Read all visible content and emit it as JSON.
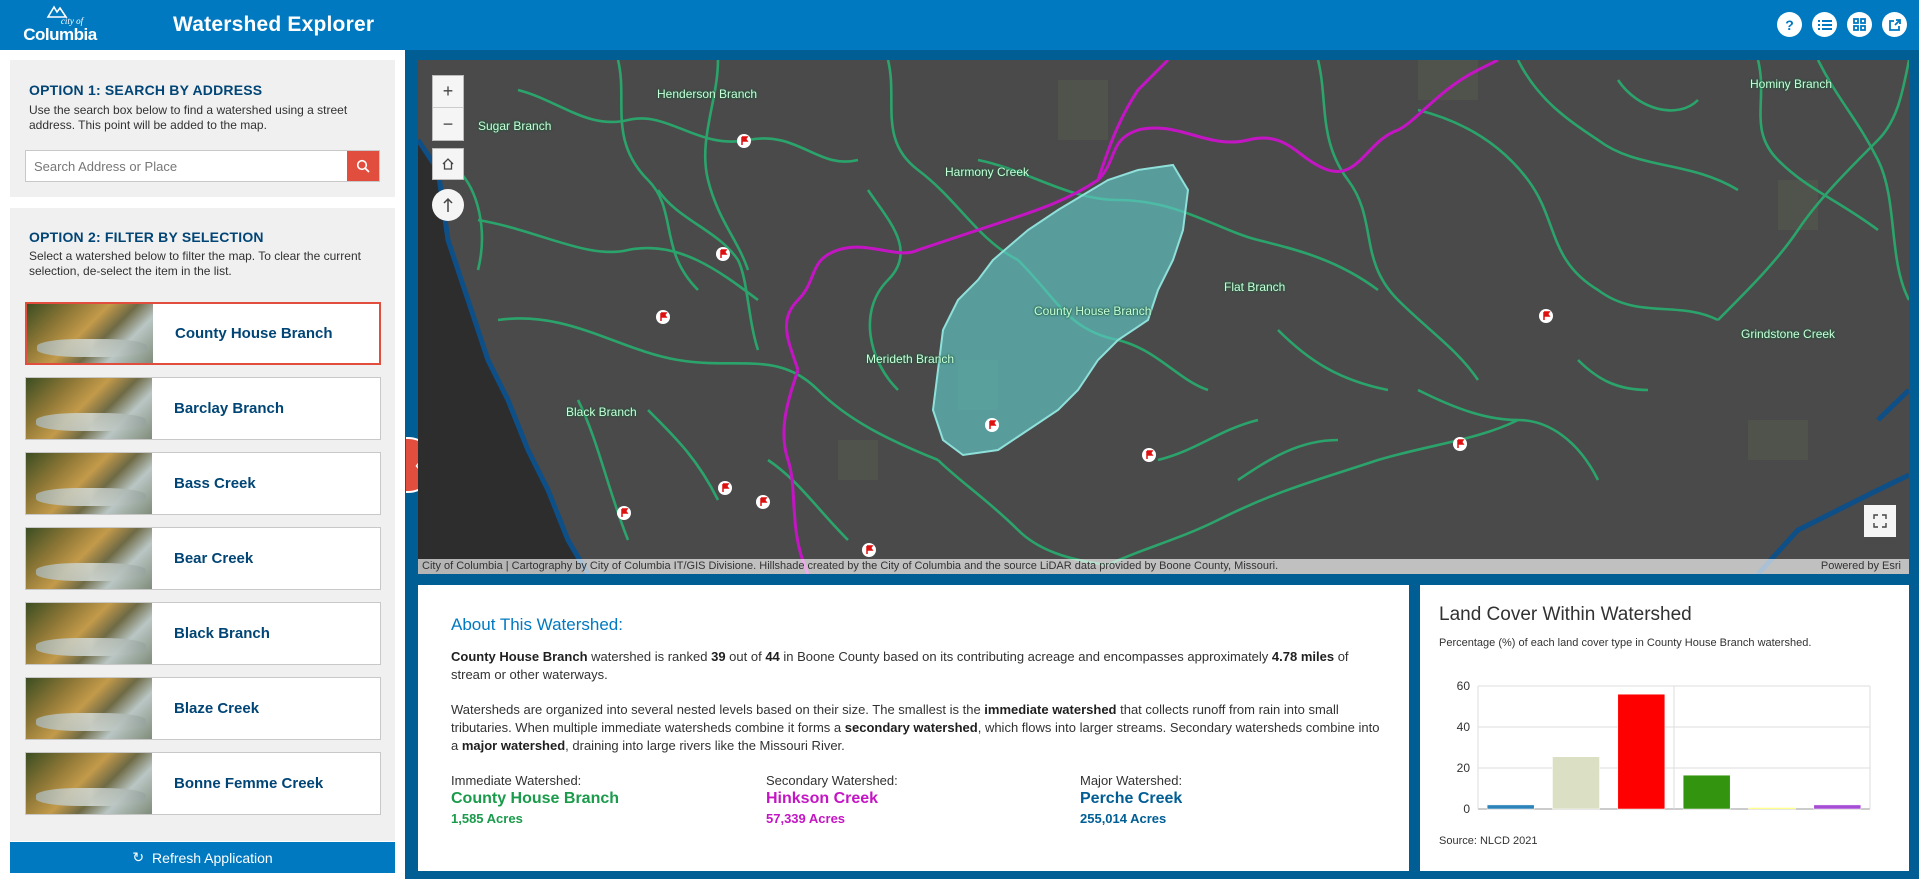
{
  "header": {
    "logo_top": "city of",
    "logo_name": "Columbia",
    "title": "Watershed Explorer",
    "icons": [
      "help-icon",
      "list-icon",
      "grid-icon",
      "share-icon"
    ],
    "bg_color": "#0079c1"
  },
  "option1": {
    "title": "OPTION 1: SEARCH BY ADDRESS",
    "description": "Use the search box below to find a watershed using a street address. This point will be added to the map.",
    "search_placeholder": "Search Address or Place"
  },
  "option2": {
    "title": "OPTION 2: FILTER BY SELECTION",
    "description": "Select a watershed below to filter the map.  To clear the current selection, de-select the item in the list.",
    "items": [
      {
        "label": "County House Branch",
        "selected": true
      },
      {
        "label": "Barclay Branch",
        "selected": false
      },
      {
        "label": "Bass Creek",
        "selected": false
      },
      {
        "label": "Bear Creek",
        "selected": false
      },
      {
        "label": "Black Branch",
        "selected": false
      },
      {
        "label": "Blaze Creek",
        "selected": false
      },
      {
        "label": "Bonne Femme Creek",
        "selected": false
      }
    ]
  },
  "refresh_label": "Refresh Application",
  "map": {
    "labels": [
      "Henderson Branch",
      "Sugar Branch",
      "Harmony Creek",
      "Hominy Branch",
      "County House Branch",
      "Flat Branch",
      "Grindstone Creek",
      "Merideth Branch",
      "Black Branch"
    ],
    "zoom_in": "+",
    "zoom_out": "−",
    "attribution": "City of Columbia | Cartography by City of Columbia IT/GIS Divisione. Hillshade created by the City of Columbia and the source LiDAR data provided by Boone County, Missouri.",
    "powered_by": "Powered by Esri"
  },
  "about": {
    "title": "About This Watershed:",
    "p1_name": "County House Branch",
    "p1_a": " watershed is ranked ",
    "p1_rank": "39",
    "p1_b": " out of ",
    "p1_total": "44",
    "p1_c": " in Boone County based on its contributing acreage and encompasses approximately ",
    "p1_miles": "4.78 miles",
    "p1_d": " of stream or other waterways.",
    "p2_a": "Watersheds are organized into several nested levels based on their size. The smallest is the ",
    "p2_b1": "immediate watershed",
    "p2_c": " that collects runoff from rain into small tributaries. When multiple immediate watersheds combine it forms a ",
    "p2_b2": "secondary watershed",
    "p2_d": ", which flows into larger streams. Secondary watersheds combine into a ",
    "p2_b3": "major watershed",
    "p2_e": ", draining into large rivers like the Missouri River.",
    "immediate": {
      "label": "Immediate Watershed:",
      "name": "County House Branch",
      "acres": "1,585 Acres",
      "color": "#1a9b4b"
    },
    "secondary": {
      "label": "Secondary Watershed:",
      "name": "Hinkson Creek",
      "acres": "57,339 Acres",
      "color": "#c415c4"
    },
    "major": {
      "label": "Major Watershed:",
      "name": "Perche Creek",
      "acres": "255,014 Acres",
      "color": "#005e95"
    }
  },
  "landcover": {
    "title": "Land Cover Within Watershed",
    "subtitle": "Percentage (%) of each land cover type in County House Branch watershed.",
    "source": "Source: NLCD 2021"
  },
  "chart_data": {
    "type": "bar",
    "categories": [
      "",
      "",
      "",
      "",
      "",
      ""
    ],
    "values": [
      2,
      25.5,
      56,
      16.5,
      0.5,
      2
    ],
    "colors": [
      "#2b83ba",
      "#dbe0c5",
      "#ff0000",
      "#33940f",
      "#ffff66",
      "#a64dd6"
    ],
    "ylim": [
      0,
      60
    ],
    "yticks": [
      0,
      20,
      40,
      60
    ],
    "grid": true
  }
}
